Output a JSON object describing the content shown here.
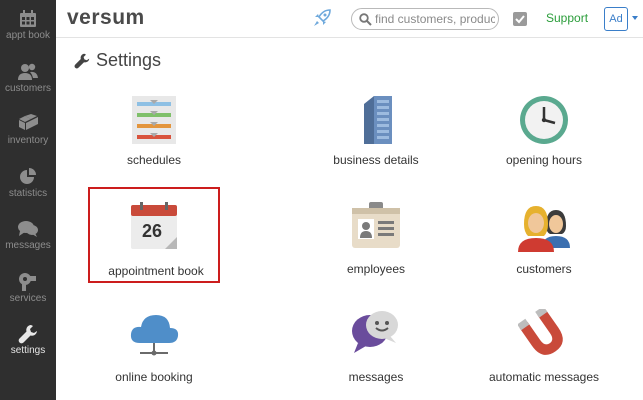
{
  "sidebar": {
    "items": [
      {
        "label": "appt book",
        "icon": "calendar-icon"
      },
      {
        "label": "customers",
        "icon": "users-icon"
      },
      {
        "label": "inventory",
        "icon": "boxes-icon"
      },
      {
        "label": "statistics",
        "icon": "pie-chart-icon"
      },
      {
        "label": "messages",
        "icon": "chat-icon"
      },
      {
        "label": "services",
        "icon": "hairdryer-icon"
      },
      {
        "label": "settings",
        "icon": "wrench-icon",
        "active": true
      }
    ]
  },
  "header": {
    "logo": "versum",
    "search_placeholder": "find customers, products",
    "support_label": "Support",
    "account_label": "Ad"
  },
  "main": {
    "title": "Settings",
    "tiles": [
      {
        "label": "schedules",
        "icon": "schedules-icon"
      },
      {
        "label": "business details",
        "icon": "building-icon"
      },
      {
        "label": "opening hours",
        "icon": "clock-icon"
      },
      {
        "label": "appointment book",
        "icon": "appointment-calendar-icon",
        "day": "26",
        "selected": true
      },
      {
        "label": "employees",
        "icon": "id-badge-icon"
      },
      {
        "label": "customers",
        "icon": "people-icon"
      },
      {
        "label": "online booking",
        "icon": "cloud-icon"
      },
      {
        "label": "messages",
        "icon": "speech-bubbles-icon"
      },
      {
        "label": "automatic messages",
        "icon": "magnet-icon"
      }
    ]
  },
  "colors": {
    "sidebar_bg": "#2f2f2f",
    "selection_border": "#cc1d1d",
    "support_link": "#2a9d3a",
    "account_blue": "#3a7ec9"
  }
}
